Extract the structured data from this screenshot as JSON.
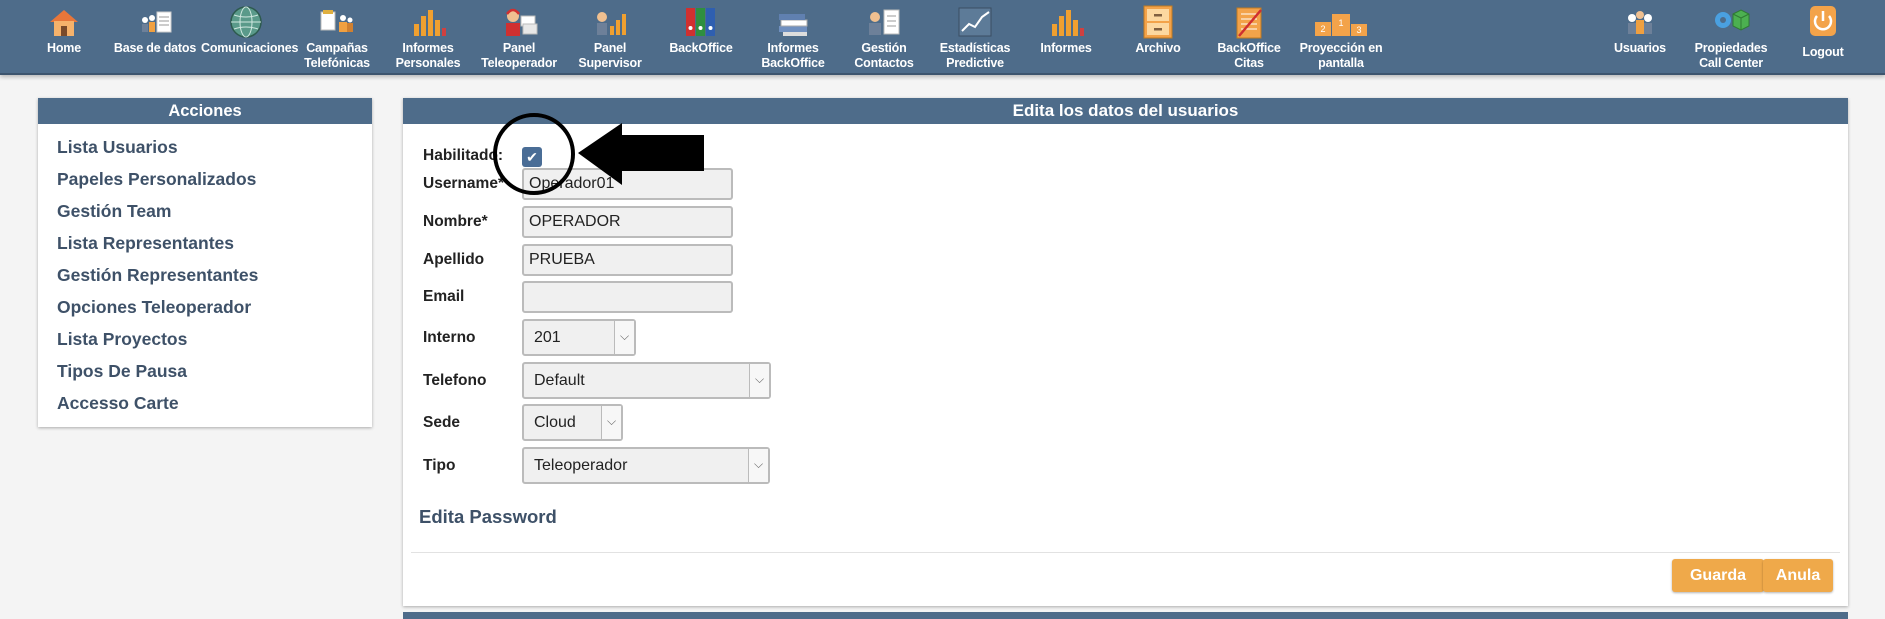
{
  "nav": {
    "home": "Home",
    "base_datos": "Base de datos",
    "comunicaciones": "Comunicaciones",
    "campanas_1": "Campañas",
    "campanas_2": "Telefónicas",
    "inf_pers_1": "Informes",
    "inf_pers_2": "Personales",
    "panel_tele_1": "Panel",
    "panel_tele_2": "Teleoperador",
    "panel_sup_1": "Panel",
    "panel_sup_2": "Supervisor",
    "backoffice": "BackOffice",
    "inf_bo_1": "Informes",
    "inf_bo_2": "BackOffice",
    "gestion_1": "Gestión",
    "gestion_2": "Contactos",
    "estad_1": "Estadísticas",
    "estad_2": "Predictive",
    "informes": "Informes",
    "archivo": "Archivo",
    "bo_citas_1": "BackOffice",
    "bo_citas_2": "Citas",
    "proy_1": "Proyección en",
    "proy_2": "pantalla",
    "usuarios": "Usuarios",
    "prop_1": "Propiedades",
    "prop_2": "Call Center",
    "logout": "Logout"
  },
  "sidebar": {
    "title": "Acciones",
    "items": [
      "Lista Usuarios",
      "Papeles Personalizados",
      "Gestión Team",
      "Lista Representantes",
      "Gestión Representantes",
      "Opciones Teleoperador",
      "Lista Proyectos",
      "Tipos De Pausa",
      "Accesso Carte"
    ]
  },
  "main": {
    "title": "Edita los datos del usuarios",
    "habilitado_label": "Habilitado:",
    "habilitado_checked": true,
    "username_label": "Username*",
    "username_value": "Operador01",
    "nombre_label": "Nombre*",
    "nombre_value": "OPERADOR",
    "apellido_label": "Apellido",
    "apellido_value": "PRUEBA",
    "email_label": "Email",
    "email_value": "",
    "interno_label": "Interno",
    "interno_value": "201",
    "telefono_label": "Telefono",
    "telefono_value": "Default",
    "sede_label": "Sede",
    "sede_value": "Cloud",
    "tipo_label": "Tipo",
    "tipo_value": "Teleoperador",
    "password_section": "Edita Password",
    "guarda": "Guarda",
    "anula": "Anula"
  },
  "colors": {
    "header": "#4e6c8a",
    "button": "#efa94a",
    "link": "#3e5168",
    "checkbox": "#4a6d96"
  }
}
